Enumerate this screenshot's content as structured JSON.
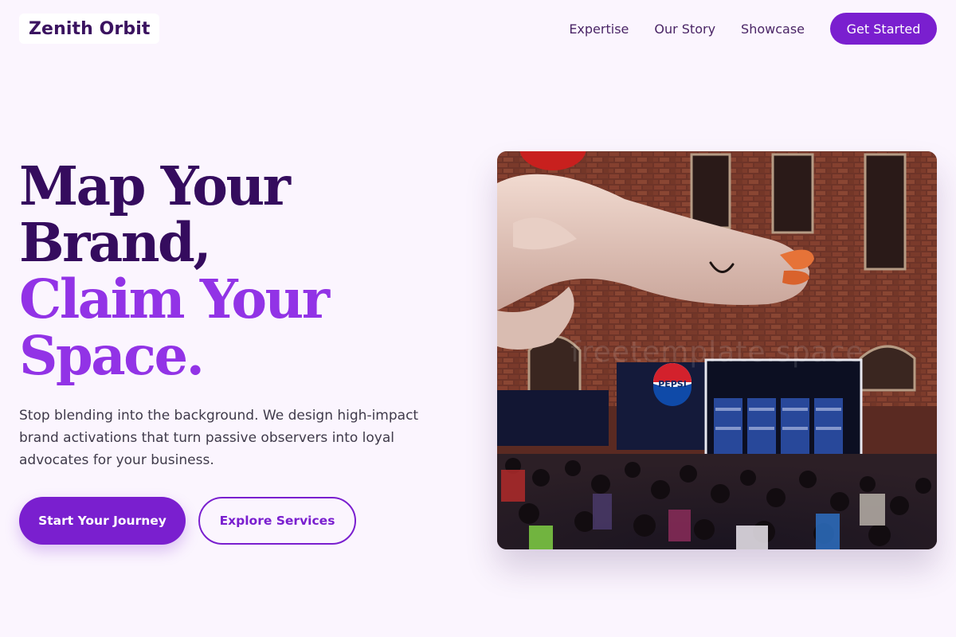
{
  "brand": {
    "name": "Zenith Orbit"
  },
  "nav": {
    "links": [
      "Expertise",
      "Our Story",
      "Showcase"
    ],
    "cta": "Get Started"
  },
  "hero": {
    "headline_line1": "Map Your",
    "headline_line2": "Brand,",
    "headline_line3": "Claim Your",
    "headline_line4": "Space.",
    "subtext": "Stop blending into the background. We design high-impact brand activations that turn passive observers into loyal advocates for your business.",
    "primary_button": "Start Your Journey",
    "secondary_button": "Explore Services",
    "image": {
      "booth_logo_text": "PEPSI",
      "watermark": "freetemplate.space"
    }
  },
  "colors": {
    "background": "#fbf5fe",
    "accent": "#7a1fcf",
    "headline_dark": "#350c5e",
    "headline_accent": "#9233e6"
  }
}
